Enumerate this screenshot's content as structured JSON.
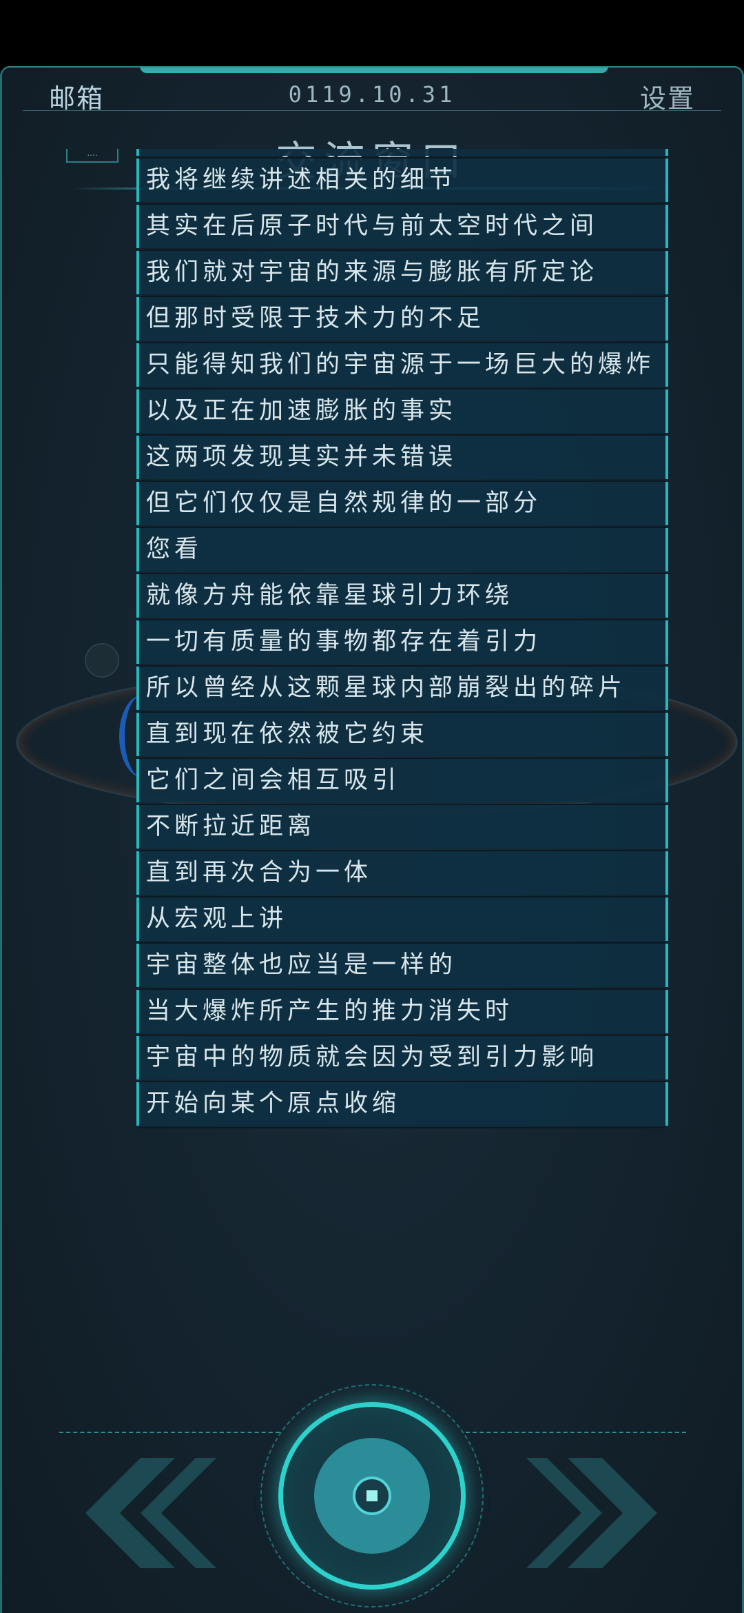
{
  "header": {
    "mail_label": "邮箱",
    "date": "0119.10.31",
    "settings_label": "设置",
    "title": "交流窗口"
  },
  "side_tag": "....",
  "messages": [
    "我将继续讲述相关的细节",
    "其实在后原子时代与前太空时代之间",
    "我们就对宇宙的来源与膨胀有所定论",
    "但那时受限于技术力的不足",
    "只能得知我们的宇宙源于一场巨大的爆炸",
    "以及正在加速膨胀的事实",
    "这两项发现其实并未错误",
    "但它们仅仅是自然规律的一部分",
    "您看",
    "就像方舟能依靠星球引力环绕",
    "一切有质量的事物都存在着引力",
    "所以曾经从这颗星球内部崩裂出的碎片",
    "直到现在依然被它约束",
    "它们之间会相互吸引",
    "不断拉近距离",
    "直到再次合为一体",
    "从宏观上讲",
    "宇宙整体也应当是一样的",
    "当大爆炸所产生的推力消失时",
    "宇宙中的物质就会因为受到引力影响",
    "开始向某个原点收缩"
  ],
  "controls": {
    "prev_icon": "double-chevron-left-icon",
    "play_icon": "play-core-icon",
    "next_icon": "double-chevron-right-icon"
  },
  "colors": {
    "accent": "#2dd2cd",
    "message_bg": "#0e3042",
    "message_border": "#27b7be",
    "text": "#d8e6ec"
  }
}
